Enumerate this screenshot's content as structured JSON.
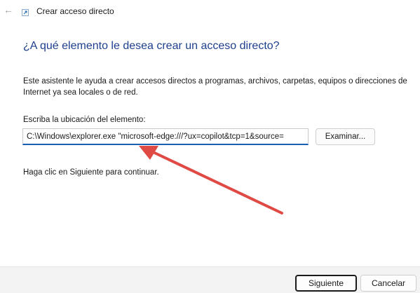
{
  "window": {
    "title": "Crear acceso directo",
    "back_icon": "arrow-left-icon",
    "app_icon": "shortcut-icon"
  },
  "main": {
    "heading": "¿A qué elemento le desea crear un acceso directo?",
    "description": "Este asistente le ayuda a crear accesos directos a programas, archivos, carpetas, equipos o direcciones de Internet ya sea locales o de red.",
    "location_label": "Escriba la ubicación del elemento:",
    "location_value": "C:\\Windows\\explorer.exe \"microsoft-edge:///?ux=copilot&tcp=1&source=",
    "browse_label": "Examinar...",
    "hint": "Haga clic en Siguiente para continuar."
  },
  "footer": {
    "next_label": "Siguiente",
    "cancel_label": "Cancelar"
  },
  "annotation": {
    "arrow_color": "#e04a45"
  },
  "colors": {
    "heading": "#1e3f8f",
    "accent": "#1a5fb4"
  }
}
